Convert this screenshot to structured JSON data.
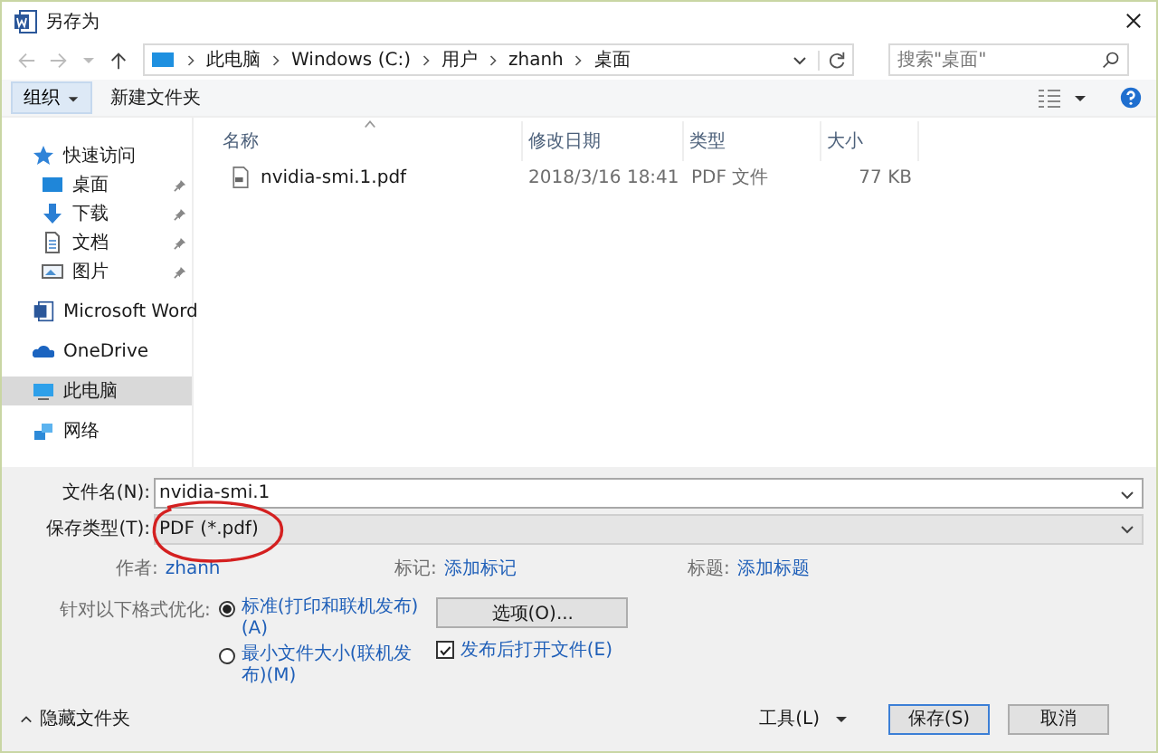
{
  "window": {
    "title": "另存为"
  },
  "address_bar": {
    "path": [
      "此电脑",
      "Windows (C:)",
      "用户",
      "zhanh",
      "桌面"
    ]
  },
  "search": {
    "placeholder": "搜索\"桌面\""
  },
  "toolbar": {
    "organize": "组织",
    "new_folder": "新建文件夹"
  },
  "sidebar": {
    "items": [
      {
        "label": "快速访问",
        "kind": "star",
        "selected": false,
        "children": [
          {
            "label": "桌面",
            "kind": "desktop",
            "pinned": true,
            "selected": false
          },
          {
            "label": "下载",
            "kind": "download",
            "pinned": true,
            "selected": false
          },
          {
            "label": "文档",
            "kind": "document",
            "pinned": true,
            "selected": false
          },
          {
            "label": "图片",
            "kind": "pictures",
            "pinned": true,
            "selected": false
          }
        ]
      },
      {
        "label": "Microsoft Word",
        "kind": "word",
        "selected": false
      },
      {
        "label": "OneDrive",
        "kind": "cloud",
        "selected": false
      },
      {
        "label": "此电脑",
        "kind": "computer",
        "selected": true
      },
      {
        "label": "网络",
        "kind": "network",
        "selected": false
      }
    ]
  },
  "table": {
    "columns": [
      "名称",
      "修改日期",
      "类型",
      "大小"
    ],
    "rows": [
      {
        "kind": "pdf",
        "cells": [
          "nvidia-smi.1.pdf",
          "2018/3/16 18:41",
          "PDF 文件",
          "77 KB"
        ]
      }
    ]
  },
  "form": {
    "file_name": {
      "label": "文件名(N):",
      "value": "nvidia-smi.1"
    },
    "file_type": {
      "label": "保存类型(T):",
      "value": "PDF (*.pdf)"
    },
    "metadata": [
      {
        "label": "作者:",
        "value": "zhanh"
      },
      {
        "label": "标记:",
        "value": "添加标记"
      },
      {
        "label": "标题:",
        "value": "添加标题"
      }
    ],
    "optimize": {
      "label": "针对以下格式优化:",
      "options": [
        {
          "label": "标准(打印和联机发布)(A)",
          "selected": true
        },
        {
          "label": "最小文件大小(联机发布)(M)",
          "selected": false
        }
      ]
    },
    "options_button": "选项(O)...",
    "open_after": {
      "label": "发布后打开文件(E)",
      "checked": true
    }
  },
  "footer": {
    "hide_folders": "隐藏文件夹",
    "tools": "工具(L)",
    "buttons": [
      {
        "label": "保存(S)",
        "default": true
      },
      {
        "label": "取消",
        "default": false
      }
    ]
  },
  "annotation": {
    "kind": "ellipse",
    "color": "#d42020"
  }
}
